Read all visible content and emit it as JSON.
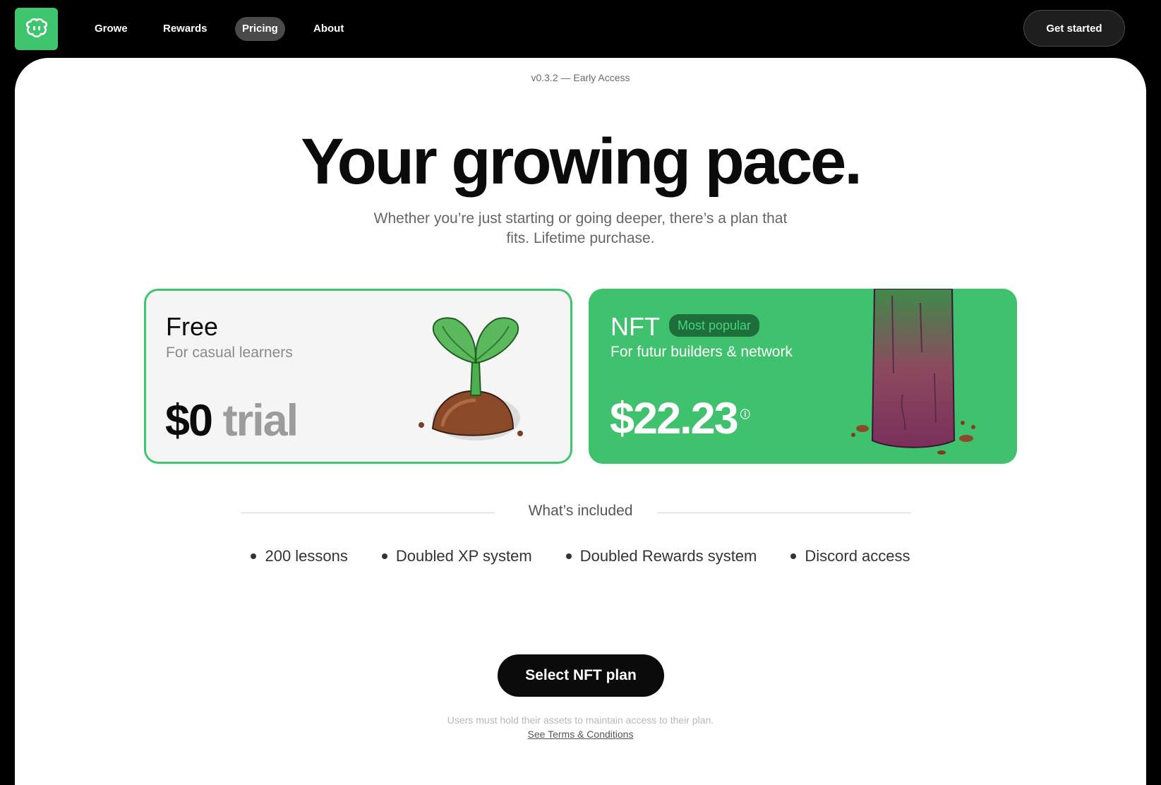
{
  "nav": {
    "logo_icon": "smiley-blob-icon",
    "links": [
      {
        "label": "Growe",
        "active": false
      },
      {
        "label": "Rewards",
        "active": false
      },
      {
        "label": "Pricing",
        "active": true
      },
      {
        "label": "About",
        "active": false
      }
    ],
    "cta_label": "Get started"
  },
  "hero": {
    "version": "v0.3.2 — Early Access",
    "headline": "Your growing pace.",
    "subtitle": "Whether you’re just starting or going deeper, there’s a plan that fits. Lifetime purchase."
  },
  "plans": {
    "free": {
      "title": "Free",
      "subtitle": "For casual learners",
      "price": "$0",
      "price_suffix": "trial",
      "illustration": "sprout-icon"
    },
    "nft": {
      "title": "NFT",
      "badge": "Most popular",
      "subtitle": "For futur builders & network",
      "price": "$22.23",
      "price_info_icon": "info-icon",
      "illustration": "tree-trunk-icon"
    }
  },
  "included": {
    "label": "What’s included",
    "features": [
      "200 lessons",
      "Doubled XP system",
      "Doubled Rewards system",
      "Discord access"
    ]
  },
  "select_label": "Select NFT plan",
  "footer": {
    "note": "Users must hold their assets to maintain access to their plan.",
    "terms_link": "See Terms & Conditions"
  },
  "colors": {
    "brand_green": "#3fc56e",
    "badge_bg": "#1d6e3b",
    "background": "#000000"
  }
}
